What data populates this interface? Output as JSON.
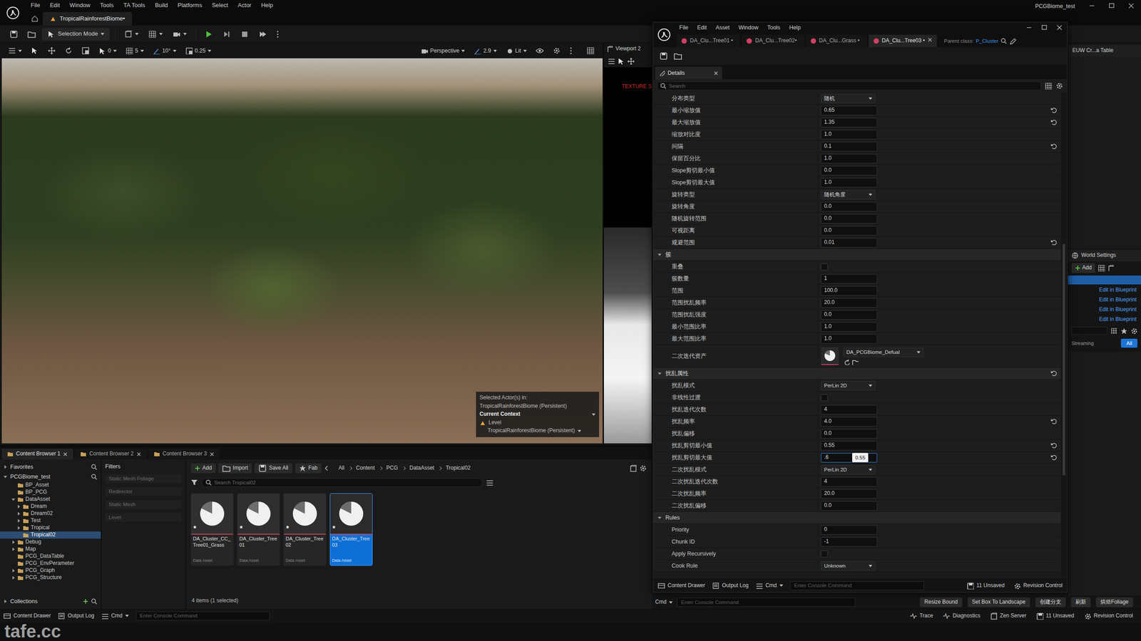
{
  "editor": {
    "menu": [
      "File",
      "Edit",
      "Window",
      "Tools",
      "TA Tools",
      "Build",
      "Platforms",
      "Select",
      "Actor",
      "Help"
    ],
    "level_tab": {
      "label": "TropicalRainforestBiome•",
      "selected": true
    },
    "project": "PCGBiome_test"
  },
  "toolbar": {
    "mode": "Selection Mode"
  },
  "viewport": {
    "snap_items": [
      "0",
      "5",
      "10°",
      "0.25"
    ],
    "view_items": [
      "Perspective",
      "2.9",
      "Lit"
    ],
    "overlay": {
      "selected_in": "Selected Actor(s) in:",
      "selected_level": "TropicalRainforestBiome (Persistent)",
      "context_title": "Current Context",
      "level_label": "Level",
      "level_value": "TropicalRainforestBiome (Persistent)"
    }
  },
  "viewport2": {
    "title": "Viewport 2",
    "text": "TEXTURE S"
  },
  "asset_editor": {
    "menu": [
      "File",
      "Edit",
      "Asset",
      "Window",
      "Tools",
      "Help"
    ],
    "tabs": [
      {
        "label": "DA_Clu...Tree01 •",
        "selected": false,
        "closable": false
      },
      {
        "label": "DA_Clu...Tree02•",
        "selected": false,
        "closable": false
      },
      {
        "label": "DA_Clu...Grass •",
        "selected": false,
        "closable": false
      },
      {
        "label": "DA_Clu...Tree03 •",
        "selected": true,
        "closable": true
      }
    ],
    "parent_class_label": "Parent class:",
    "parent_class": "P_Cluster",
    "details": {
      "tab": "Details",
      "search_placeholder": "Search",
      "rows": [
        {
          "label": "分布类型",
          "kind": "dropdown",
          "value": "随机",
          "reset": false
        },
        {
          "label": "最小缩放值",
          "kind": "number",
          "value": "0.65",
          "reset": true
        },
        {
          "label": "最大缩放值",
          "kind": "number",
          "value": "1.35",
          "reset": true
        },
        {
          "label": "缩放对比度",
          "kind": "number",
          "value": "1.0",
          "reset": false
        },
        {
          "label": "间隔",
          "kind": "number",
          "value": "0.1",
          "reset": true
        },
        {
          "label": "保留百分比",
          "kind": "number",
          "value": "1.0",
          "reset": false
        },
        {
          "label": "Slope剪切最小值",
          "kind": "number",
          "value": "0.0",
          "reset": false
        },
        {
          "label": "Slope剪切最大值",
          "kind": "number",
          "value": "1.0",
          "reset": false
        },
        {
          "label": "旋转类型",
          "kind": "dropdown",
          "value": "随机角度",
          "reset": false
        },
        {
          "label": "旋转角度",
          "kind": "number",
          "value": "0.0",
          "reset": false
        },
        {
          "label": "随机旋转范围",
          "kind": "number",
          "value": "0.0",
          "reset": false
        },
        {
          "label": "可视距离",
          "kind": "number",
          "value": "0.0",
          "reset": false
        },
        {
          "label": "规避范围",
          "kind": "number",
          "value": "0.01",
          "reset": true
        }
      ],
      "sections": [
        {
          "title": "簇",
          "expanded": true,
          "reset": false,
          "rows": [
            {
              "label": "重叠",
              "kind": "checkbox",
              "checked": false,
              "reset": false
            },
            {
              "label": "簇数量",
              "kind": "number",
              "value": "1",
              "reset": false
            },
            {
              "label": "范围",
              "kind": "number",
              "value": "100.0",
              "reset": false
            },
            {
              "label": "范围扰乱频率",
              "kind": "number",
              "value": "20.0",
              "reset": false
            },
            {
              "label": "范围扰乱强度",
              "kind": "number",
              "value": "0.0",
              "reset": false
            },
            {
              "label": "最小范围比率",
              "kind": "number",
              "value": "1.0",
              "reset": false
            },
            {
              "label": "最大范围比率",
              "kind": "number",
              "value": "1.0",
              "reset": false
            },
            {
              "label": "二次迭代资产",
              "kind": "asset",
              "value": "DA_PCGBiome_Defual",
              "reset": false
            }
          ]
        },
        {
          "title": "扰乱属性",
          "expanded": true,
          "reset": true,
          "rows": [
            {
              "label": "扰乱模式",
              "kind": "dropdown",
              "value": "PerLin 2D",
              "reset": false
            },
            {
              "label": "非线性过渡",
              "kind": "checkbox",
              "checked": false,
              "reset": false
            },
            {
              "label": "扰乱迭代次数",
              "kind": "number",
              "value": "4",
              "reset": false
            },
            {
              "label": "扰乱频率",
              "kind": "number",
              "value": "4.0",
              "reset": true
            },
            {
              "label": "扰乱偏移",
              "kind": "number",
              "value": "0.0",
              "reset": false
            },
            {
              "label": "扰乱剪切最小值",
              "kind": "number",
              "value": "0.55",
              "reset": true
            },
            {
              "label": "扰乱剪切最大值",
              "kind": "editing",
              "value": ".6",
              "tooltip": "0.55",
              "reset": true
            },
            {
              "label": "二次扰乱模式",
              "kind": "dropdown",
              "value": "PerLin 2D",
              "reset": false
            },
            {
              "label": "二次扰乱迭代次数",
              "kind": "number",
              "value": "4",
              "reset": false
            },
            {
              "label": "二次扰乱频率",
              "kind": "number",
              "value": "20.0",
              "reset": false
            },
            {
              "label": "二次扰乱偏移",
              "kind": "number",
              "value": "0.0",
              "reset": false
            }
          ]
        },
        {
          "title": "Rules",
          "expanded": true,
          "reset": false,
          "rows": [
            {
              "label": "Priority",
              "kind": "number",
              "value": "0",
              "reset": false
            },
            {
              "label": "Chunk ID",
              "kind": "number",
              "value": "-1",
              "reset": false
            },
            {
              "label": "Apply Recursively",
              "kind": "checkbox",
              "checked": false,
              "reset": false
            },
            {
              "label": "Cook Rule",
              "kind": "dropdown",
              "value": "Unknown",
              "reset": false
            }
          ]
        }
      ]
    },
    "bottom": {
      "content_drawer": "Content Drawer",
      "output_log": "Output Log",
      "cmd": "Cmd",
      "console_placeholder": "Enter Console Command",
      "unsaved": "11 Unsaved",
      "revision": "Revision Control"
    }
  },
  "content_browser": {
    "tabs": [
      {
        "label": "Content Browser 1",
        "selected": true
      },
      {
        "label": "Content Browser 2",
        "selected": false
      },
      {
        "label": "Content Browser 3",
        "selected": false
      }
    ],
    "favorites": {
      "label": "Favorites",
      "expanded": false
    },
    "root": {
      "label": "PCGBiome_test",
      "expanded": true
    },
    "tree": [
      {
        "label": "BP_Asset",
        "selected": false
      },
      {
        "label": "BP_PCG",
        "selected": false
      },
      {
        "label": "DataAsset",
        "expanded": true,
        "selected": false,
        "children": [
          {
            "label": "Dream",
            "expanded": false,
            "selected": false
          },
          {
            "label": "Dream02",
            "expanded": false,
            "selected": false
          },
          {
            "label": "Test",
            "expanded": false,
            "selected": false
          },
          {
            "label": "Tropical",
            "expanded": false,
            "selected": false
          },
          {
            "label": "Tropical02",
            "selected": true
          }
        ]
      },
      {
        "label": "Debug",
        "expanded": false,
        "selected": false
      },
      {
        "label": "Map",
        "expanded": false,
        "selected": false
      },
      {
        "label": "PCG_DataTable",
        "selected": false
      },
      {
        "label": "PCG_EnvPerameter",
        "selected": false
      },
      {
        "label": "PCG_Graph",
        "expanded": false,
        "selected": false
      },
      {
        "label": "PCG_Structure",
        "expanded": false,
        "selected": false
      }
    ],
    "collections": {
      "label": "Collections",
      "expanded": false
    },
    "filters_title": "Filters",
    "filters": [
      "Static Mesh Foliage",
      "Redirector",
      "Static Mesh",
      "Level"
    ],
    "actions": [
      "Add",
      "Import",
      "Save All",
      "Fab"
    ],
    "path": [
      "All",
      "Content",
      "PCG",
      "DataAsset",
      "Tropical02"
    ],
    "search_placeholder": "Search Tropical02",
    "assets": [
      {
        "name": "DA_Cluster_CC_Tree01_Grass",
        "type": "Data Asset",
        "mark": "*",
        "selected": false
      },
      {
        "name": "DA_Cluster_Tree01",
        "type": "Data Asset",
        "mark": "*",
        "selected": false
      },
      {
        "name": "DA_Cluster_Tree02",
        "type": "Data Asset",
        "mark": "*",
        "selected": false
      },
      {
        "name": "DA_Cluster_Tree03",
        "type": "Data Asset",
        "mark": "*",
        "selected": true
      }
    ],
    "count": "4 items (1 selected)"
  },
  "side_panel": {
    "tab": "EUW Cr...a Table",
    "world_settings": "World Settings",
    "add": "Add",
    "links": [
      "Edit in Blueprint",
      "Edit in Blueprint",
      "Edit in Blueprint",
      "Edit in Blueprint"
    ],
    "streaming": "Streaming",
    "all": {
      "label": "All",
      "selected": true
    }
  },
  "command_strip": {
    "cmd": "Cmd",
    "placeholder": "Enter Console Command",
    "buttons": [
      "Resize Bound",
      "Set Box To Landscape",
      "创建分支",
      "刷新",
      "烘焙Foliage"
    ]
  },
  "status_bar": {
    "left": [
      "Content Drawer",
      "Output Log",
      "Cmd"
    ],
    "placeholder": "Enter Console Command",
    "right": [
      "Trace",
      "Diagnostics",
      "Zen Server",
      "11 Unsaved",
      "Revision Control"
    ]
  },
  "watermark": "tafe.cc"
}
